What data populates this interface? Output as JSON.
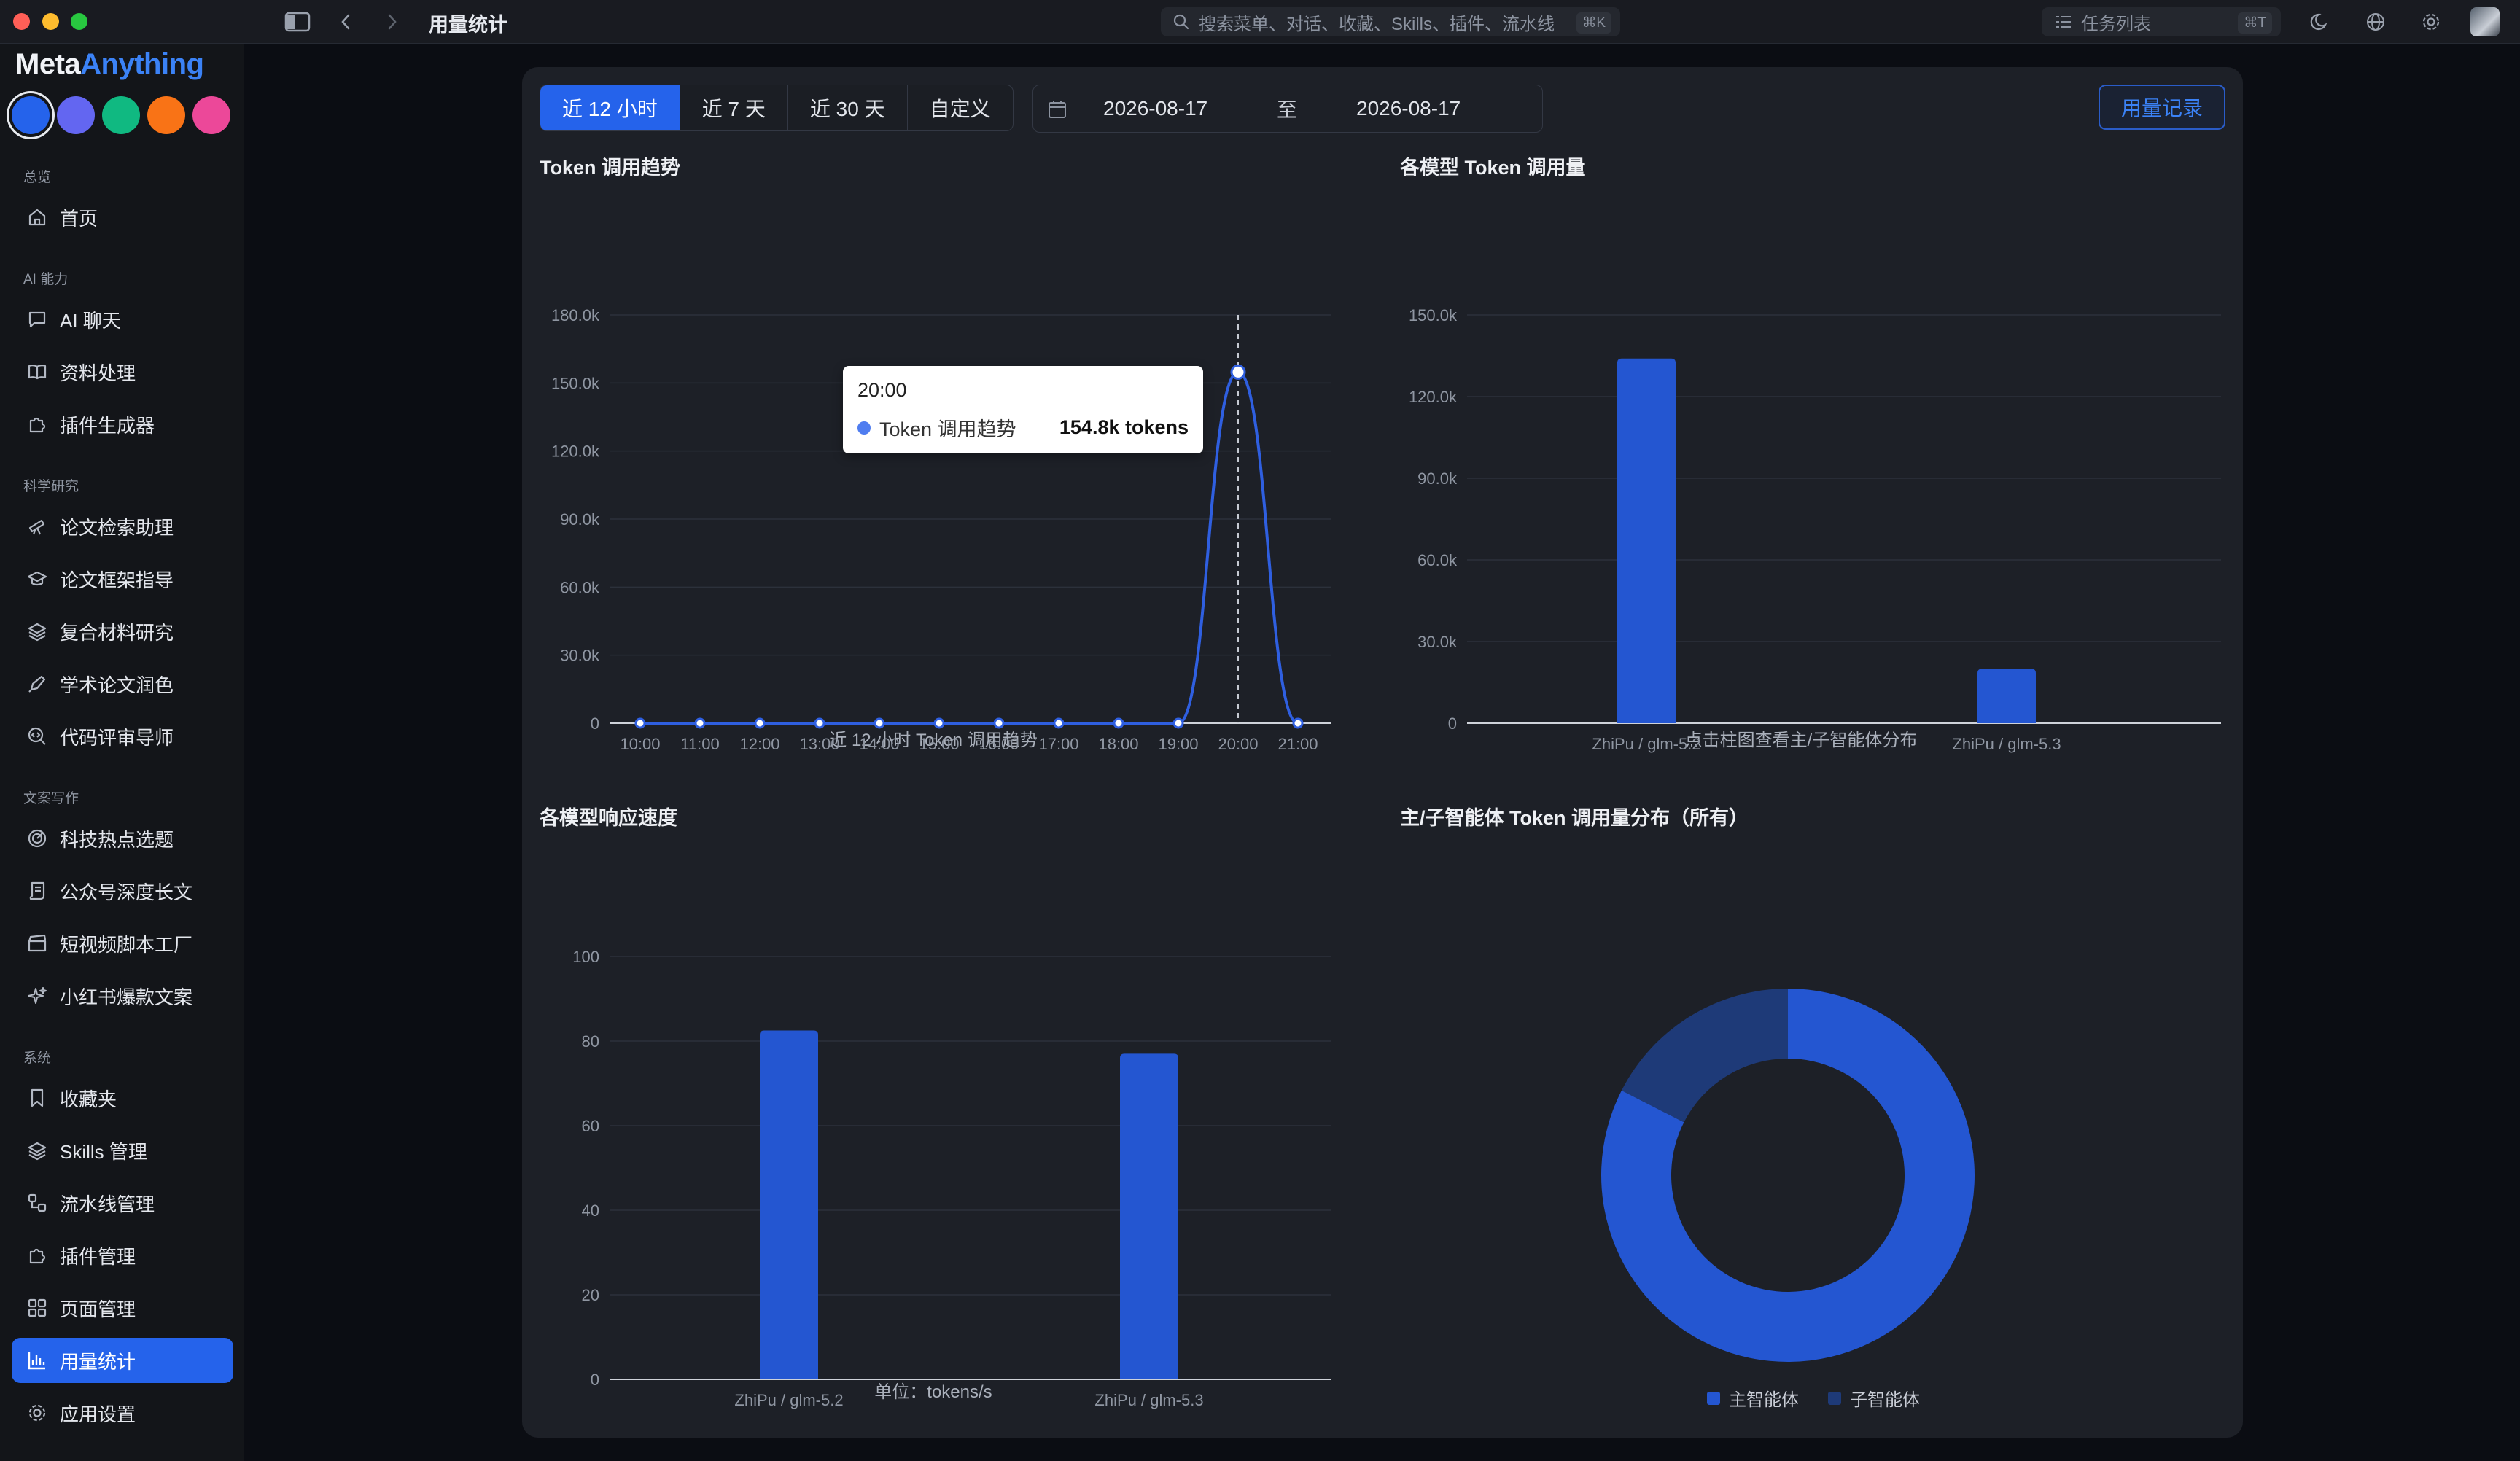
{
  "window": {
    "title": "用量统计",
    "search_placeholder": "搜索菜单、对话、收藏、Skills、插件、流水线",
    "search_shortcut": "⌘K",
    "tasks_label": "任务列表",
    "tasks_shortcut": "⌘T"
  },
  "brand": {
    "part1": "Meta",
    "part2": "Anything"
  },
  "theme_swatches": [
    "#2563eb",
    "#6366f1",
    "#10b981",
    "#f97316",
    "#ec4899"
  ],
  "sidebar": {
    "sections": [
      {
        "label": "总览",
        "items": [
          {
            "label": "首页",
            "icon": "home-icon"
          }
        ]
      },
      {
        "label": "AI 能力",
        "items": [
          {
            "label": "AI 聊天",
            "icon": "chat-icon"
          },
          {
            "label": "资料处理",
            "icon": "book-icon"
          },
          {
            "label": "插件生成器",
            "icon": "puzzle-icon"
          }
        ]
      },
      {
        "label": "科学研究",
        "items": [
          {
            "label": "论文检索助理",
            "icon": "telescope-icon"
          },
          {
            "label": "论文框架指导",
            "icon": "graduation-cap-icon"
          },
          {
            "label": "复合材料研究",
            "icon": "layers-icon"
          },
          {
            "label": "学术论文润色",
            "icon": "pen-icon"
          },
          {
            "label": "代码评审导师",
            "icon": "code-search-icon"
          }
        ]
      },
      {
        "label": "文案写作",
        "items": [
          {
            "label": "科技热点选题",
            "icon": "radar-icon"
          },
          {
            "label": "公众号深度长文",
            "icon": "scroll-icon"
          },
          {
            "label": "短视频脚本工厂",
            "icon": "clapperboard-icon"
          },
          {
            "label": "小红书爆款文案",
            "icon": "sparkles-icon"
          }
        ]
      },
      {
        "label": "系统",
        "items": [
          {
            "label": "收藏夹",
            "icon": "bookmark-icon"
          },
          {
            "label": "Skills 管理",
            "icon": "layers-icon"
          },
          {
            "label": "流水线管理",
            "icon": "workflow-icon"
          },
          {
            "label": "插件管理",
            "icon": "puzzle-icon"
          },
          {
            "label": "页面管理",
            "icon": "grid-icon"
          },
          {
            "label": "用量统计",
            "icon": "bar-chart-icon",
            "active": true
          },
          {
            "label": "应用设置",
            "icon": "gear-icon"
          }
        ]
      }
    ]
  },
  "toolbar": {
    "ranges": [
      "近 12 小时",
      "近 7 天",
      "近 30 天",
      "自定义"
    ],
    "active_range": "近 12 小时",
    "date_from": "2026-08-17",
    "date_sep": "至",
    "date_to": "2026-08-17",
    "usage_button": "用量记录"
  },
  "chart_data": [
    {
      "type": "line",
      "title": "Token 调用趋势",
      "caption": "近 12 小时 Token 调用趋势",
      "x": [
        "10:00",
        "11:00",
        "12:00",
        "13:00",
        "14:00",
        "15:00",
        "16:00",
        "17:00",
        "18:00",
        "19:00",
        "20:00",
        "21:00"
      ],
      "series": [
        {
          "name": "Token 调用趋势",
          "values": [
            0,
            0,
            0,
            0,
            0,
            0,
            0,
            0,
            0,
            0,
            154800,
            0
          ]
        }
      ],
      "yticks": [
        "0",
        "30.0k",
        "60.0k",
        "90.0k",
        "120.0k",
        "150.0k",
        "180.0k"
      ],
      "ylim": [
        0,
        180000
      ],
      "grid": true,
      "color": "#2f5fe0",
      "tooltip": {
        "time": "20:00",
        "label": "Token 调用趋势",
        "value": "154.8k tokens"
      }
    },
    {
      "type": "bar",
      "title": "各模型 Token 调用量",
      "caption": "点击柱图查看主/子智能体分布",
      "categories": [
        "ZhiPu / glm-5.2",
        "ZhiPu / glm-5.3"
      ],
      "values": [
        134000,
        20000
      ],
      "yticks": [
        "0",
        "30.0k",
        "60.0k",
        "90.0k",
        "120.0k",
        "150.0k"
      ],
      "ylim": [
        0,
        150000
      ],
      "grid": true,
      "color": "#2456d1"
    },
    {
      "type": "bar",
      "title": "各模型响应速度",
      "caption": "单位：tokens/s",
      "categories": [
        "ZhiPu / glm-5.2",
        "ZhiPu / glm-5.3"
      ],
      "values": [
        82.5,
        77
      ],
      "yticks": [
        "0",
        "20",
        "40",
        "60",
        "80",
        "100"
      ],
      "ylim": [
        0,
        100
      ],
      "grid": true,
      "color": "#2456d1"
    },
    {
      "type": "pie",
      "title": "主/子智能体 Token 调用量分布（所有）",
      "labels": [
        "主智能体",
        "子智能体"
      ],
      "values": [
        82.5,
        17.5
      ],
      "colors": [
        "#2456d1",
        "#1e3a78"
      ],
      "legend": "bottom"
    }
  ]
}
